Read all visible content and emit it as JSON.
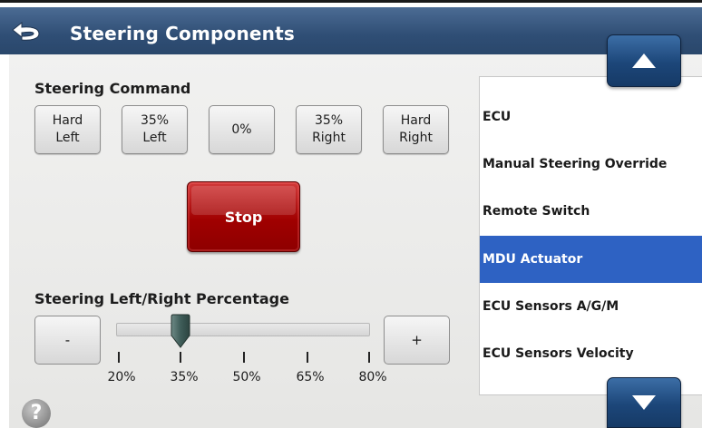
{
  "header": {
    "title": "Steering Components"
  },
  "steering_command": {
    "label": "Steering Command",
    "buttons": [
      {
        "label": "Hard\nLeft"
      },
      {
        "label": "35%\nLeft"
      },
      {
        "label": "0%"
      },
      {
        "label": "35%\nRight"
      },
      {
        "label": "Hard\nRight"
      }
    ],
    "stop_label": "Stop"
  },
  "percentage": {
    "label": "Steering Left/Right Percentage",
    "minus_label": "-",
    "plus_label": "+",
    "ticks": [
      "20%",
      "35%",
      "50%",
      "65%",
      "80%"
    ],
    "value_percent": 35
  },
  "component_list": {
    "items": [
      {
        "label": "ECU"
      },
      {
        "label": "Manual Steering Override"
      },
      {
        "label": "Remote Switch"
      },
      {
        "label": "MDU Actuator"
      },
      {
        "label": "ECU Sensors A/G/M"
      },
      {
        "label": "ECU Sensors Velocity"
      }
    ],
    "selected": "MDU Actuator"
  },
  "help_label": "?",
  "colors": {
    "title_bar": "#2f4e75",
    "selected_row": "#2e62c3",
    "stop_button": "#a00000",
    "scroll_button": "#1c4679"
  },
  "icons": {
    "back": "back-arrow-icon",
    "scroll_up": "up-arrow-icon",
    "scroll_down": "down-arrow-icon",
    "help": "help-icon",
    "slider_thumb": "slider-thumb-icon"
  }
}
